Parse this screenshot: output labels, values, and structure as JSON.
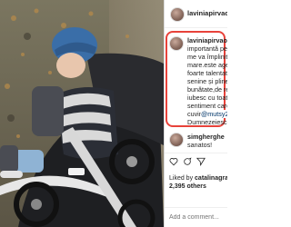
{
  "post": {
    "username": "laviniapirvaofficial",
    "caption_username": "laviniapirvaofficial",
    "caption_lines": [
      "importantă pentr",
      "me va împlinit 6",
      "mare.este ager,",
      "foarte talentat.i",
      "senine și pline d",
      "bunătate,de reali",
      "iubesc cu toată f",
      "sentiment care n",
      "cuvinte .Este un",
      "Dumnezeiesc!"
    ],
    "caption_mention": "@mutsy2",
    "comment": {
      "username": "simgherghe",
      "text": "sanatos!"
    },
    "liked_by_prefix": "Liked by",
    "liked_by_user": "catalinagra",
    "likes_count": "2,395 others",
    "add_comment_placeholder": "Add a comment..."
  },
  "colors": {
    "highlight_border": "#e8423a"
  }
}
